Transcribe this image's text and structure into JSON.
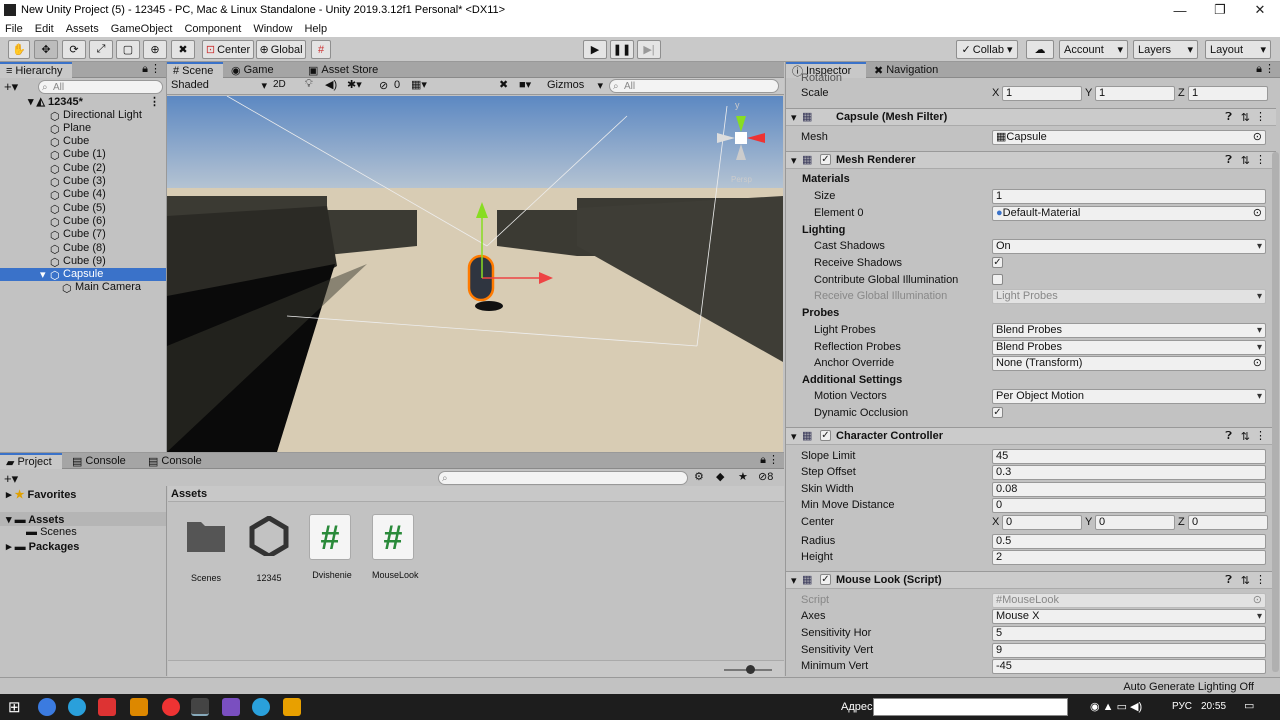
{
  "window": {
    "title": "New Unity Project (5) - 12345 - PC, Mac & Linux Standalone - Unity 2019.3.12f1 Personal* <DX11>"
  },
  "menu": [
    "File",
    "Edit",
    "Assets",
    "GameObject",
    "Component",
    "Window",
    "Help"
  ],
  "toolbar": {
    "center": "Center",
    "global": "Global",
    "collab": "Collab",
    "account": "Account",
    "layers": "Layers",
    "layout": "Layout"
  },
  "hierarchy": {
    "tab": "Hierarchy",
    "search": "All",
    "scene": "12345*",
    "items": [
      "Directional Light",
      "Plane",
      "Cube",
      "Cube (1)",
      "Cube (2)",
      "Cube (3)",
      "Cube (4)",
      "Cube (5)",
      "Cube (6)",
      "Cube (7)",
      "Cube (8)",
      "Cube (9)",
      "Capsule",
      "Main Camera"
    ]
  },
  "scene": {
    "tabs": [
      "Scene",
      "Game",
      "Asset Store"
    ],
    "shading": "Shaded",
    "mode2d": "2D",
    "hidden_count": "0",
    "gizmos": "Gizmos",
    "search": "All",
    "axis_y": "y",
    "persp": "Persp"
  },
  "project": {
    "tabs": [
      "Project",
      "Console",
      "Console"
    ],
    "hidden": "8",
    "favorites": "Favorites",
    "assets": "Assets",
    "scenes": "Scenes",
    "packages": "Packages",
    "header": "Assets",
    "files": [
      "Scenes",
      "12345",
      "Dvishenie",
      "MouseLook"
    ]
  },
  "inspector": {
    "tabs": [
      "Inspector",
      "Navigation"
    ],
    "rotation_label": "Rotation",
    "scale_label": "Scale",
    "scale": [
      "1",
      "1",
      "1"
    ],
    "mesh_filter": {
      "title": "Capsule (Mesh Filter)",
      "mesh_label": "Mesh",
      "mesh": "Capsule"
    },
    "mesh_renderer": {
      "title": "Mesh Renderer",
      "materials": "Materials",
      "size_label": "Size",
      "size": "1",
      "element_label": "Element 0",
      "element": "Default-Material",
      "lighting": "Lighting",
      "cast_label": "Cast Shadows",
      "cast": "On",
      "receive_label": "Receive Shadows",
      "contrib_label": "Contribute Global Illumination",
      "rgi_label": "Receive Global Illumination",
      "rgi": "Light Probes",
      "probes": "Probes",
      "lp_label": "Light Probes",
      "lp": "Blend Probes",
      "rp_label": "Reflection Probes",
      "rp": "Blend Probes",
      "ao_label": "Anchor Override",
      "ao": "None (Transform)",
      "additional": "Additional Settings",
      "mv_label": "Motion Vectors",
      "mv": "Per Object Motion",
      "do_label": "Dynamic Occlusion"
    },
    "char_controller": {
      "title": "Character Controller",
      "slope_label": "Slope Limit",
      "slope": "45",
      "step_label": "Step Offset",
      "step": "0.3",
      "skin_label": "Skin Width",
      "skin": "0.08",
      "minmove_label": "Min Move Distance",
      "minmove": "0",
      "center_label": "Center",
      "center": [
        "0",
        "0",
        "0"
      ],
      "radius_label": "Radius",
      "radius": "0.5",
      "height_label": "Height",
      "height": "2"
    },
    "mouse_look": {
      "title": "Mouse Look (Script)",
      "script_label": "Script",
      "script": "MouseLook",
      "axes_label": "Axes",
      "axes": "Mouse X",
      "shor_label": "Sensitivity Hor",
      "shor": "5",
      "svert_label": "Sensitivity Vert",
      "svert": "9",
      "minv_label": "Minimum Vert",
      "minv": "-45"
    }
  },
  "status": {
    "right": "Auto Generate Lighting Off"
  },
  "taskbar": {
    "address": "Адрес",
    "lang": "РУС",
    "time": "20:55"
  }
}
